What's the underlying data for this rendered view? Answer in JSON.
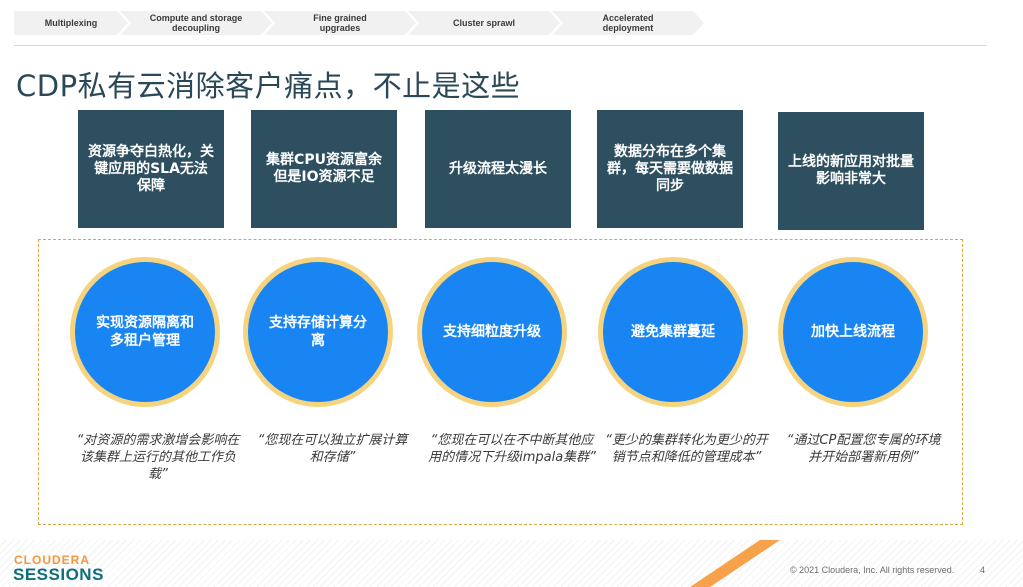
{
  "breadcrumb": [
    "Multiplexing",
    "Compute and storage decoupling",
    "Fine grained upgrades",
    "Cluster sprawl",
    "Accelerated deployment"
  ],
  "title": "CDP私有云消除客户痛点，不止是这些",
  "pain_points": [
    "资源争夺白热化，关键应用的SLA无法保障",
    "集群CPU资源富余但是IO资源不足",
    "升级流程太漫长",
    "数据分布在多个集群，每天需要做数据同步",
    "上线的新应用对批量影响非常大"
  ],
  "solutions": [
    "实现资源隔离和多租户管理",
    "支持存储计算分离",
    "支持细粒度升级",
    "避免集群蔓延",
    "加快上线流程"
  ],
  "quotes": [
    "“对资源的需求激增会影响在该集群上运行的其他工作负载”",
    "“您现在可以独立扩展计算和存储”",
    "“您现在可以在不中断其他应用的情况下升级impala集群”",
    "“更少的集群转化为更少的开销节点和降低的管理成本”",
    "“通过CP配置您专属的环境并开始部署新用例”"
  ],
  "footer": {
    "logo_top": "CLOUDERA",
    "logo_bottom": "SESSIONS",
    "copyright": "© 2021 Cloudera, Inc. All rights reserved.",
    "page_number": "4"
  },
  "colors": {
    "pain_box": "#2e4f5f",
    "circle_fill": "#1985f3",
    "circle_ring": "#f5d37f",
    "accent_orange": "#f7963d",
    "brand_teal": "#0f6e7d"
  }
}
